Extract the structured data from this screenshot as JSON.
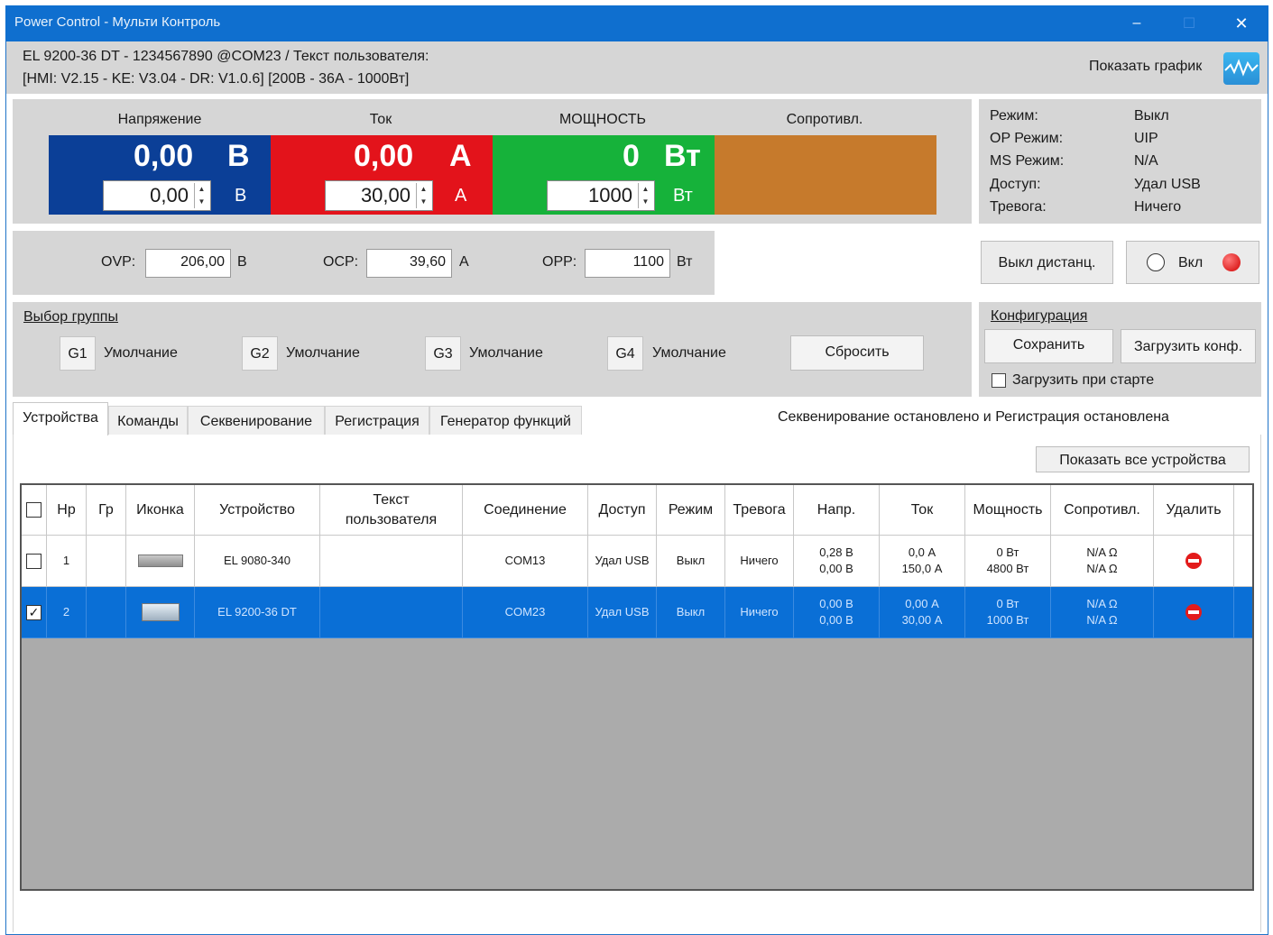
{
  "window": {
    "title": "Power Control - Мульти Контроль",
    "min": "‒",
    "max": "☐",
    "close": "✕"
  },
  "info": {
    "line1": "EL 9200-36 DT - 1234567890 @COM23 / Текст пользователя:",
    "line2": "[HMI: V2.15 - KE: V3.04 - DR: V1.0.6] [200В - 36А - 1000Вт]",
    "show_graph": "Показать график"
  },
  "control": {
    "voltage": {
      "header": "Напряжение",
      "actual": "0,00",
      "unit": "В",
      "set": "0,00",
      "set_unit": "В",
      "color": "#0b3f97"
    },
    "current": {
      "header": "Ток",
      "actual": "0,00",
      "unit": "А",
      "set": "30,00",
      "set_unit": "А",
      "color": "#e3131b"
    },
    "power": {
      "header": "МОЩНОСТЬ",
      "actual": "0",
      "unit": "Вт",
      "set": "1000",
      "set_unit": "Вт",
      "color": "#16b23a"
    },
    "resistance": {
      "header": "Сопротивл.",
      "color": "#c67a2c"
    }
  },
  "status": {
    "rows": [
      {
        "label": "Режим:",
        "value": "Выкл"
      },
      {
        "label": "OP Режим:",
        "value": "UIP"
      },
      {
        "label": "MS Режим:",
        "value": "N/A"
      },
      {
        "label": "Доступ:",
        "value": "Удал USB"
      },
      {
        "label": "Тревога:",
        "value": "Ничего"
      }
    ]
  },
  "protection": {
    "ovp": {
      "label": "OVP:",
      "value": "206,00",
      "unit": "В"
    },
    "ocp": {
      "label": "OCP:",
      "value": "39,60",
      "unit": "А"
    },
    "opp": {
      "label": "OPP:",
      "value": "1100",
      "unit": "Вт"
    }
  },
  "remote": {
    "off_label": "Выкл дистанц.",
    "on_label": "Вкл"
  },
  "groups": {
    "title": "Выбор группы",
    "items": [
      {
        "id": "G1",
        "name": "Умолчание"
      },
      {
        "id": "G2",
        "name": "Умолчание"
      },
      {
        "id": "G3",
        "name": "Умолчание"
      },
      {
        "id": "G4",
        "name": "Умолчание"
      }
    ],
    "reset": "Сбросить"
  },
  "config": {
    "title": "Конфигурация",
    "save": "Сохранить",
    "load": "Загрузить конф.",
    "load_on_start": "Загрузить при старте"
  },
  "tabs": [
    "Устройства",
    "Команды",
    "Секвенирование",
    "Регистрация",
    "Генератор функций"
  ],
  "seq_status": "Секвенирование остановлено и Регистрация остановлена",
  "show_all": "Показать все устройства",
  "table": {
    "headers": [
      "Нр",
      "Гр",
      "Иконка",
      "Устройство",
      "Текст пользователя",
      "Соединение",
      "Доступ",
      "Режим",
      "Тревога",
      "Напр.",
      "Ток",
      "Мощность",
      "Сопротивл.",
      "Удалить"
    ],
    "rows": [
      {
        "checked": "",
        "nr": "1",
        "gr": "",
        "device": "EL 9080-340",
        "text": "",
        "conn": "COM13",
        "access": "Удал USB",
        "mode": "Выкл",
        "alarm": "Ничего",
        "u1": "0,28 В",
        "u2": "0,00 В",
        "i1": "0,0 А",
        "i2": "150,0 А",
        "p1": "0 Вт",
        "p2": "4800 Вт",
        "r1": "N/A Ω",
        "r2": "N/A Ω"
      },
      {
        "checked": "✓",
        "nr": "2",
        "gr": "",
        "device": "EL 9200-36 DT",
        "text": "",
        "conn": "COM23",
        "access": "Удал USB",
        "mode": "Выкл",
        "alarm": "Ничего",
        "u1": "0,00 В",
        "u2": "0,00 В",
        "i1": "0,00 А",
        "i2": "30,00 А",
        "p1": "0 Вт",
        "p2": "1000 Вт",
        "r1": "N/A Ω",
        "r2": "N/A Ω"
      }
    ]
  }
}
